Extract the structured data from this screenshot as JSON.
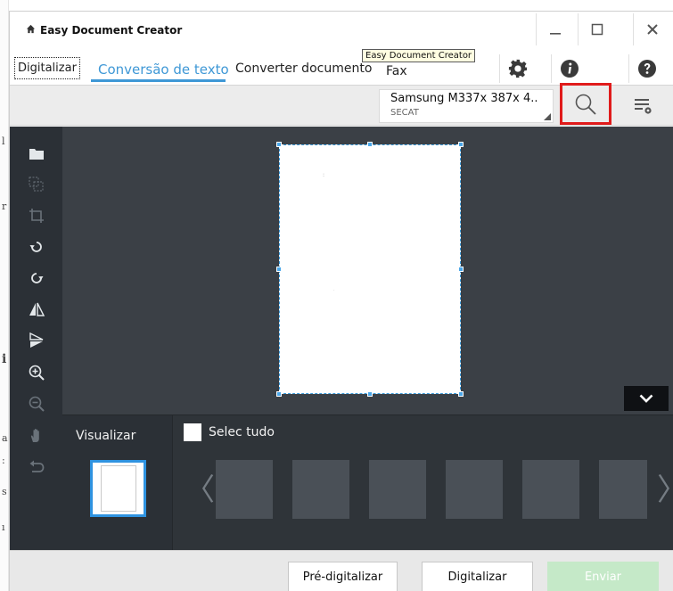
{
  "app": {
    "title": "Easy Document Creator"
  },
  "window_controls": {
    "minimize_glyph": "—",
    "maximize_glyph": "☐",
    "close_glyph": "✕"
  },
  "tabs": [
    {
      "label": "Digitalizar",
      "active": false
    },
    {
      "label": "Conversão de texto",
      "active": true
    },
    {
      "label": "Converter documento",
      "active": false
    },
    {
      "label": "Fax",
      "active": false
    }
  ],
  "tooltip": "Easy Document Creator",
  "device": {
    "name": "Samsung M337x 387x 4..",
    "location": "SECAT"
  },
  "left_toolbar": [
    {
      "icon": "folder-icon",
      "enabled": true
    },
    {
      "icon": "select-area-icon",
      "enabled": false
    },
    {
      "icon": "crop-icon",
      "enabled": false
    },
    {
      "icon": "rotate-left-icon",
      "enabled": true
    },
    {
      "icon": "rotate-right-icon",
      "enabled": true
    },
    {
      "icon": "flip-horizontal-icon",
      "enabled": true
    },
    {
      "icon": "flip-vertical-icon",
      "enabled": true
    },
    {
      "icon": "zoom-in-icon",
      "enabled": true
    },
    {
      "icon": "zoom-out-icon",
      "enabled": false
    },
    {
      "icon": "pan-hand-icon",
      "enabled": false
    },
    {
      "icon": "undo-icon",
      "enabled": false
    }
  ],
  "bottom": {
    "visualizar_label": "Visualizar",
    "select_all_label": "Selec tudo",
    "left_arrow": "〈",
    "right_arrow": "〉"
  },
  "footer": {
    "prescan_label": "Pré-digitalizar",
    "scan_label": "Digitalizar",
    "send_label": "Enviar"
  },
  "colors": {
    "accent": "#3f98d6",
    "highlight_box": "#e01b1b",
    "send_disabled": "#c5e9c8"
  }
}
